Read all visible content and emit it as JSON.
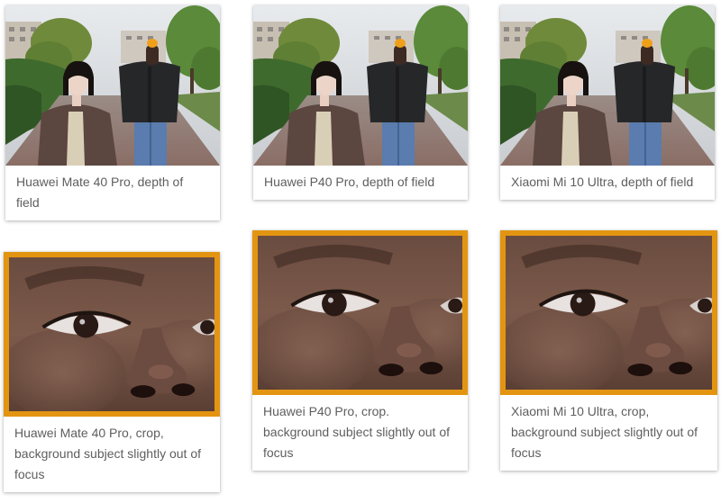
{
  "accent_color": "#e39512",
  "gallery": {
    "row1": [
      {
        "caption": "Huawei Mate 40 Pro, depth of field",
        "image": "portrait-two-people-street"
      },
      {
        "caption": "Huawei P40 Pro, depth of field",
        "image": "portrait-two-people-street"
      },
      {
        "caption": "Xiaomi Mi 10 Ultra, depth of field",
        "image": "portrait-two-people-street"
      }
    ],
    "row2": [
      {
        "caption": "Huawei Mate 40 Pro, crop, background subject slightly out of focus",
        "image": "face-crop-eyes-nose"
      },
      {
        "caption": "Huawei P40 Pro, crop. background subject slightly out of focus",
        "image": "face-crop-eyes-nose"
      },
      {
        "caption": "Xiaomi Mi 10 Ultra, crop, background subject slightly out of focus",
        "image": "face-crop-eyes-nose"
      }
    ]
  }
}
